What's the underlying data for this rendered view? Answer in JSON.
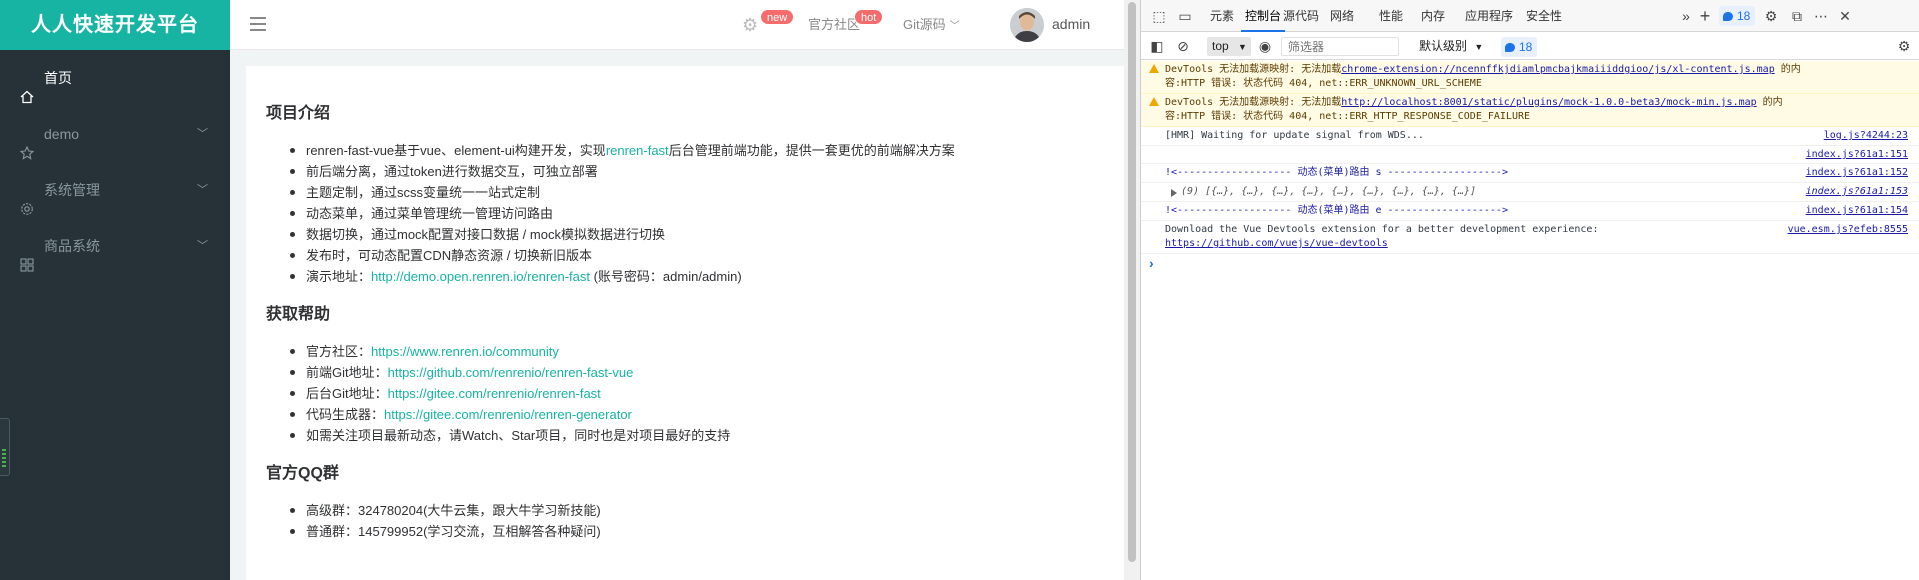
{
  "app": {
    "brand": "人人快速开发平台",
    "sidebar": {
      "items": [
        {
          "label": "首页",
          "icon": "home-icon",
          "active": true,
          "has_arrow": false
        },
        {
          "label": "demo",
          "icon": "star-icon",
          "active": false,
          "has_arrow": true
        },
        {
          "label": "系统管理",
          "icon": "gear-icon",
          "active": false,
          "has_arrow": true
        },
        {
          "label": "商品系统",
          "icon": "grid-icon",
          "active": false,
          "has_arrow": true
        }
      ]
    },
    "navbar": {
      "gear_badge": "new",
      "community_label": "官方社区",
      "community_badge": "hot",
      "git_label": "Git源码",
      "username": "admin"
    },
    "content": {
      "intro_title": "项目介绍",
      "intro_items": [
        {
          "before": "renren-fast-vue基于vue、element-ui构建开发，实现",
          "link": "renren-fast",
          "after": "后台管理前端功能，提供一套更优的前端解决方案"
        },
        {
          "before": "前后端分离，通过token进行数据交互，可独立部署",
          "link": "",
          "after": ""
        },
        {
          "before": "主题定制，通过scss变量统一一站式定制",
          "link": "",
          "after": ""
        },
        {
          "before": "动态菜单，通过菜单管理统一管理访问路由",
          "link": "",
          "after": ""
        },
        {
          "before": "数据切换，通过mock配置对接口数据 / mock模拟数据进行切换",
          "link": "",
          "after": ""
        },
        {
          "before": "发布时，可动态配置CDN静态资源 / 切换新旧版本",
          "link": "",
          "after": ""
        },
        {
          "before": "演示地址：",
          "link": "http://demo.open.renren.io/renren-fast",
          "after": " (账号密码：admin/admin)"
        }
      ],
      "help_title": "获取帮助",
      "help_items": [
        {
          "before": "官方社区：",
          "link": "https://www.renren.io/community",
          "after": ""
        },
        {
          "before": "前端Git地址：",
          "link": "https://github.com/renrenio/renren-fast-vue",
          "after": ""
        },
        {
          "before": "后台Git地址：",
          "link": "https://gitee.com/renrenio/renren-fast",
          "after": ""
        },
        {
          "before": "代码生成器：",
          "link": "https://gitee.com/renrenio/renren-generator",
          "after": ""
        },
        {
          "before": "如需关注项目最新动态，请Watch、Star项目，同时也是对项目最好的支持",
          "link": "",
          "after": ""
        }
      ],
      "qq_title": "官方QQ群",
      "qq_items": [
        {
          "before": "高级群：324780204(大牛云集，跟大牛学习新技能)",
          "link": "",
          "after": ""
        },
        {
          "before": "普通群：145799952(学习交流，互相解答各种疑问)",
          "link": "",
          "after": ""
        }
      ]
    }
  },
  "devtools": {
    "tabs": [
      {
        "label": "元素",
        "active": false
      },
      {
        "label": "控制台",
        "active": true
      },
      {
        "label": "源代码",
        "active": false
      },
      {
        "label": "网络",
        "active": false
      },
      {
        "label": "性能",
        "active": false
      },
      {
        "label": "内存",
        "active": false
      },
      {
        "label": "应用程序",
        "active": false
      },
      {
        "label": "安全性",
        "active": false
      }
    ],
    "issue_count": "18",
    "context": "top",
    "filter_placeholder": "筛选器",
    "level": "默认级别",
    "toolbar_issue_count": "18",
    "logs": [
      {
        "type": "warn",
        "text": "DevTools 无法加载源映射: 无法加载",
        "link": "chrome-extension://ncennffkjdiamlpmcbajkmaiiiddgioo/js/xl-content.js.map",
        "after": " 的内",
        "line2": "容:HTTP 错误: 状态代码 404, net::ERR_UNKNOWN_URL_SCHEME",
        "src": ""
      },
      {
        "type": "warn",
        "text": "DevTools 无法加载源映射: 无法加载",
        "link": "http://localhost:8001/static/plugins/mock-1.0.0-beta3/mock-min.js.map",
        "after": " 的内",
        "line2": "容:HTTP 错误: 状态代码 404, net::ERR_HTTP_RESPONSE_CODE_FAILURE",
        "src": ""
      },
      {
        "type": "log",
        "text": "[HMR] Waiting for update signal from WDS...",
        "link": "",
        "after": "",
        "line2": "",
        "src": "log.js?4244:23"
      },
      {
        "type": "log",
        "text": "",
        "link": "",
        "after": "",
        "line2": "",
        "src": "index.js?61a1:151"
      },
      {
        "type": "blue",
        "text": "!<------------------- 动态(菜单)路由 s ------------------->",
        "link": "",
        "after": "",
        "line2": "",
        "src": "index.js?61a1:152"
      },
      {
        "type": "obj",
        "text": "(9) [{…}, {…}, {…}, {…}, {…}, {…}, {…}, {…}, {…}]",
        "link": "",
        "after": "",
        "line2": "",
        "src": "index.js?61a1:153"
      },
      {
        "type": "blue",
        "text": "!<------------------- 动态(菜单)路由 e ------------------->",
        "link": "",
        "after": "",
        "line2": "",
        "src": "index.js?61a1:154"
      },
      {
        "type": "log",
        "text": "Download the Vue Devtools extension for a better development experience:",
        "link": "",
        "after": "",
        "line2link": "https://github.com/vuejs/vue-devtools",
        "src": "vue.esm.js?efeb:8555"
      }
    ]
  }
}
